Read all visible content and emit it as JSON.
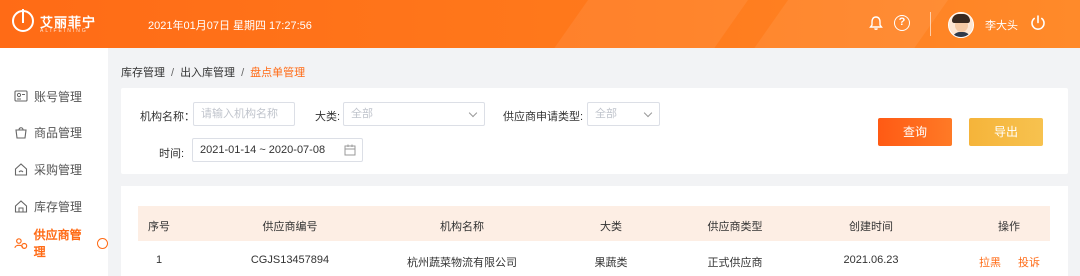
{
  "header": {
    "logo_text": "艾丽菲宁",
    "logo_subtext": "ALIFEINING",
    "datetime": "2021年01月07日 星期四 17:27:56",
    "username": "李大头"
  },
  "sidebar": {
    "items": [
      {
        "label": "账号管理",
        "icon": "account-icon",
        "active": false
      },
      {
        "label": "商品管理",
        "icon": "goods-icon",
        "active": false
      },
      {
        "label": "采购管理",
        "icon": "purchase-icon",
        "active": false
      },
      {
        "label": "库存管理",
        "icon": "inventory-icon",
        "active": false
      },
      {
        "label": "供应商管理",
        "icon": "supplier-icon",
        "active": true
      }
    ]
  },
  "breadcrumb": {
    "items": [
      "库存管理",
      "出入库管理"
    ],
    "current": "盘点单管理",
    "separator": "/"
  },
  "filters": {
    "org_label": "机构名称：",
    "org_placeholder": "请输入机构名称",
    "category_label": "大类:",
    "category_value": "全部",
    "supplier_type_label": "供应商申请类型:",
    "supplier_type_value": "全部",
    "time_label": "时间:",
    "date_range": "2021-01-14 ~ 2020-07-08",
    "query_button": "查询",
    "export_button": "导出"
  },
  "table": {
    "headers": [
      "序号",
      "供应商编号",
      "机构名称",
      "大类",
      "供应商类型",
      "创建时间",
      "操作"
    ],
    "rows": [
      {
        "index": "1",
        "supplier_code": "CGJS13457894",
        "org_name": "杭州蔬菜物流有限公司",
        "category": "果蔬类",
        "supplier_type": "正式供应商",
        "created": "2021.06.23",
        "actions": [
          "拉黑",
          "投诉"
        ]
      }
    ]
  },
  "colors": {
    "accent": "#ff6b16",
    "export": "#f5b43a",
    "table_header_bg": "#fdeee4"
  }
}
